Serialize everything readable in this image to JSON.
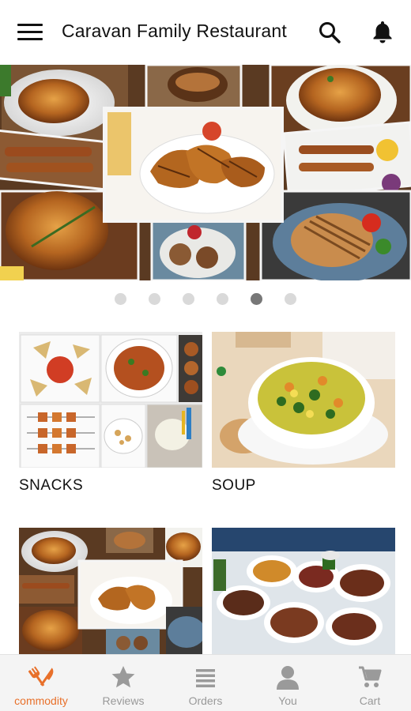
{
  "header": {
    "title": "Caravan Family Restaurant",
    "menu_icon": "hamburger-menu-icon",
    "search_icon": "search-icon",
    "notification_icon": "bell-icon"
  },
  "banner": {
    "slide_count": 6,
    "active_index": 4
  },
  "categories": [
    {
      "label": "SNACKS"
    },
    {
      "label": "SOUP"
    },
    {
      "label": ""
    },
    {
      "label": ""
    }
  ],
  "bottom_nav": {
    "items": [
      {
        "label": "commodity",
        "icon": "fork-knife-icon",
        "active": true
      },
      {
        "label": "Reviews",
        "icon": "star-icon",
        "active": false
      },
      {
        "label": "Orders",
        "icon": "list-icon",
        "active": false
      },
      {
        "label": "You",
        "icon": "person-icon",
        "active": false
      },
      {
        "label": "Cart",
        "icon": "cart-icon",
        "active": false
      }
    ]
  },
  "colors": {
    "accent": "#e8702a",
    "inactive": "#999999",
    "dot_active": "#777777",
    "dot_inactive": "#d9d9d9"
  }
}
